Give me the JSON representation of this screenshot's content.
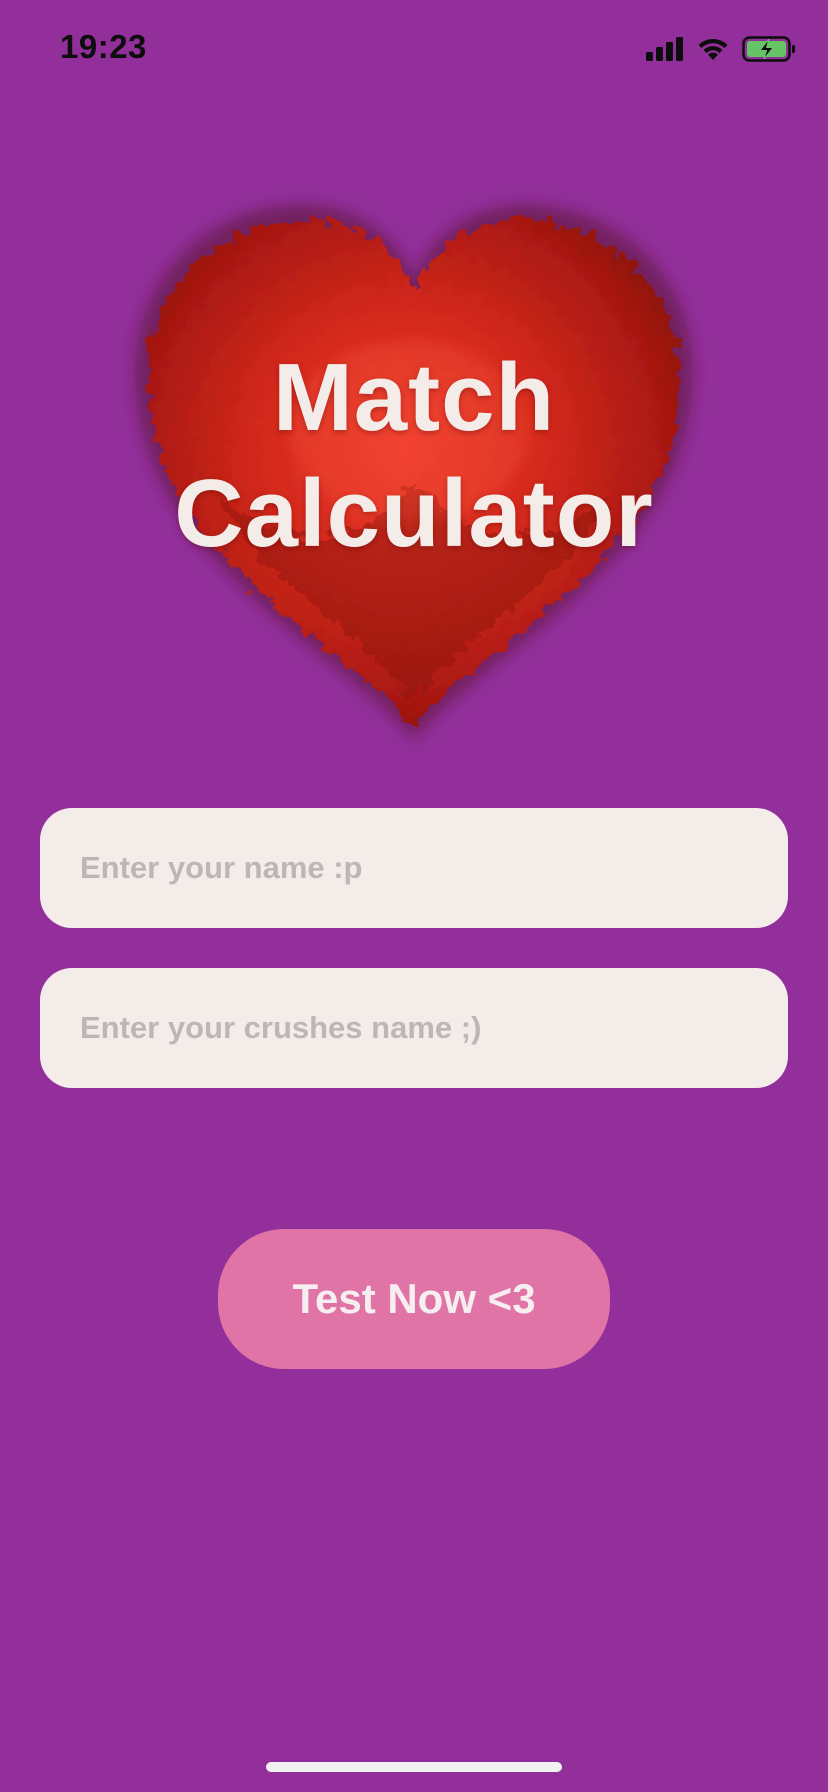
{
  "status_bar": {
    "time": "19:23",
    "icons": [
      "cellular-signal-icon",
      "wifi-icon",
      "battery-charging-icon"
    ]
  },
  "hero": {
    "image": "fluffy-red-heart",
    "title_line1": "Match",
    "title_line2": "Calculator"
  },
  "form": {
    "name_placeholder": "Enter your name :p",
    "name_value": "",
    "crush_placeholder": "Enter your crushes name ;)",
    "crush_value": ""
  },
  "action": {
    "test_label": "Test Now <3"
  },
  "colors": {
    "background": "#922f9a",
    "input_bg": "#f3ece9",
    "placeholder": "#bdb6b4",
    "button_bg": "#e074a6",
    "button_text": "#f7eef0",
    "title_text": "#f4ece9",
    "heart_red": "#c9231a",
    "battery_green": "#65c466"
  }
}
